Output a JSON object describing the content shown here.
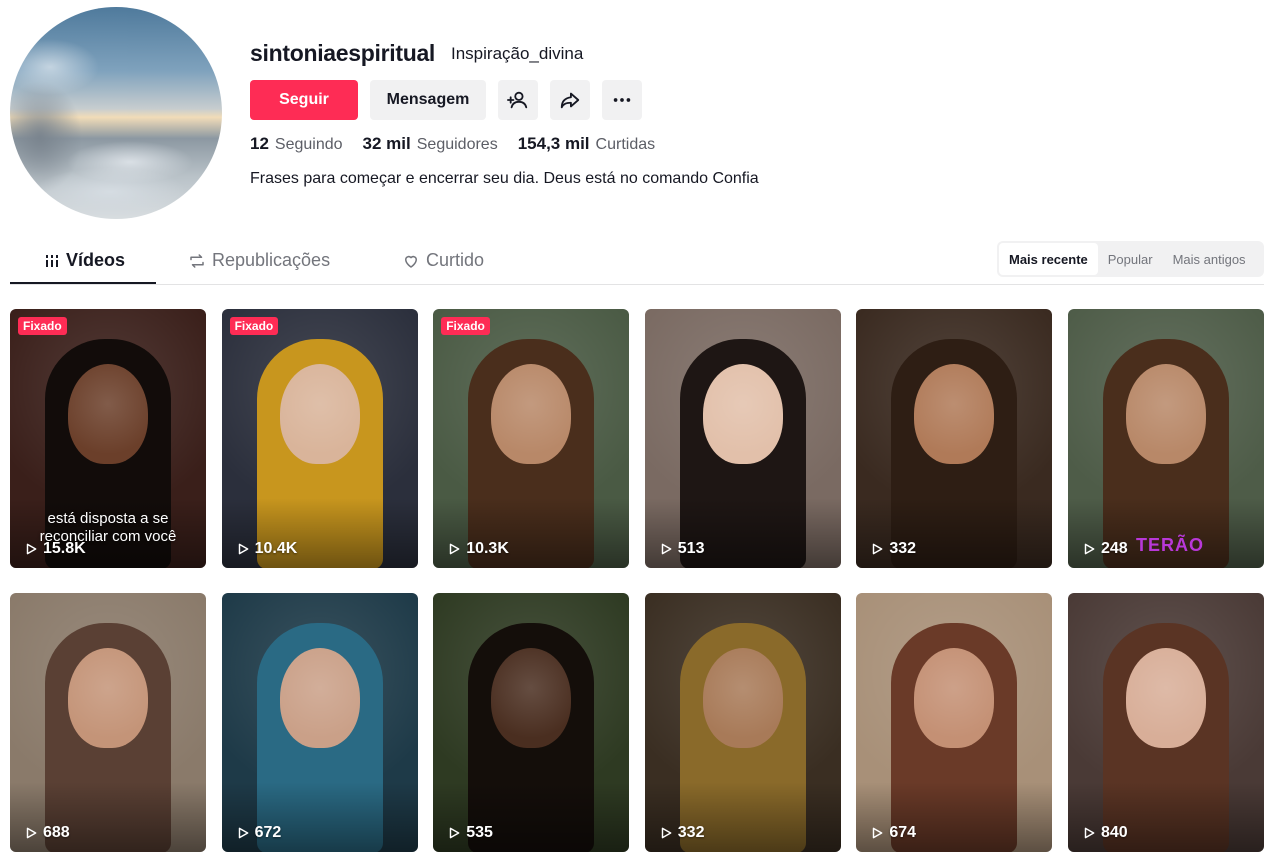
{
  "profile": {
    "username": "sintoniaespiritual",
    "nickname": "Inspiração_divina",
    "follow_label": "Seguir",
    "message_label": "Mensagem",
    "bio": "Frases para começar e encerrar seu dia. Deus está no comando Confia"
  },
  "stats": {
    "following_count": "12",
    "following_label": "Seguindo",
    "followers_count": "32 mil",
    "followers_label": "Seguidores",
    "likes_count": "154,3 mil",
    "likes_label": "Curtidas"
  },
  "tabs": [
    {
      "label": "Vídeos",
      "icon": "grid-icon",
      "active": true
    },
    {
      "label": "Republicações",
      "icon": "repost-icon",
      "active": false
    },
    {
      "label": "Curtido",
      "icon": "heart-icon",
      "active": false
    }
  ],
  "sort": [
    "Mais recente",
    "Popular",
    "Mais antigos"
  ],
  "colors": {
    "accent": "#fe2c55",
    "text": "#161823",
    "muted": "#73757c",
    "button_bg": "#f1f1f2"
  },
  "videos": [
    {
      "views": "15.8K",
      "pinned": "Fixado",
      "overlay": "está disposta a se reconciliar com você",
      "bg": "#3a1f1a",
      "face": "#6b3f2a",
      "hair": "#120c0a"
    },
    {
      "views": "10.4K",
      "pinned": "Fixado",
      "bg": "#2b2f3c",
      "face": "#d9b49a",
      "hair": "#c8961e"
    },
    {
      "views": "10.3K",
      "pinned": "Fixado",
      "bg": "#4a5a44",
      "face": "#b88868",
      "hair": "#4a2e1c"
    },
    {
      "views": "513",
      "bg": "#7a6a62",
      "face": "#e2c0aa",
      "hair": "#1e1614"
    },
    {
      "views": "332",
      "bg": "#3a2a20",
      "face": "#b07a58",
      "hair": "#2e1e14"
    },
    {
      "views": "248",
      "tag": "TERÃO",
      "bg": "#4e5c48",
      "face": "#b88868",
      "hair": "#4a2e1c"
    },
    {
      "views": "688",
      "bg": "#8a7a6a",
      "face": "#c49478",
      "hair": "#5a4034"
    },
    {
      "views": "672",
      "bg": "#1e3a48",
      "face": "#caa088",
      "hair": "#2a6a84"
    },
    {
      "views": "535",
      "bg": "#2e3a22",
      "face": "#4a2e20",
      "hair": "#140e0a"
    },
    {
      "views": "332",
      "bg": "#3a2e22",
      "face": "#a87a58",
      "hair": "#8a6a2a"
    },
    {
      "views": "674",
      "bg": "#a89078",
      "face": "#c49074",
      "hair": "#6a3a28"
    },
    {
      "views": "840",
      "bg": "#4a3a36",
      "face": "#d8ae98",
      "hair": "#5a3424"
    }
  ]
}
